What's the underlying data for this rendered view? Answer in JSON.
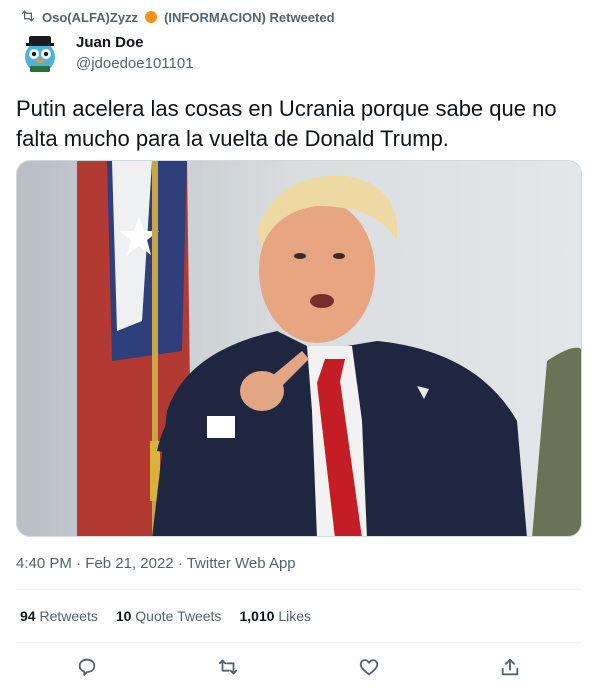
{
  "retweet_header": {
    "user": "Oso(ALFA)Zyzz",
    "suffix": "(INFORMACION) Retweeted"
  },
  "author": {
    "name": "Juan Doe",
    "handle": "@jdoedoe101101"
  },
  "tweet": {
    "text": "Putin acelera las cosas en Ucrania porque sabe que no falta mucho para la vuelta de Donald Trump."
  },
  "meta": {
    "time": "4:40 PM",
    "date": "Feb 21, 2022",
    "source": "Twitter Web App"
  },
  "stats": {
    "retweets_count": "94",
    "retweets_label": "Retweets",
    "quotes_count": "10",
    "quotes_label": "Quote Tweets",
    "likes_count": "1,010",
    "likes_label": "Likes"
  },
  "icons": {
    "retweet_header": "retweet-icon",
    "reply": "reply-icon",
    "retweet": "retweet-icon",
    "like": "heart-icon",
    "share": "share-icon"
  },
  "colors": {
    "text_primary": "#0f1419",
    "text_secondary": "#536471",
    "divider": "#eff3f4"
  }
}
